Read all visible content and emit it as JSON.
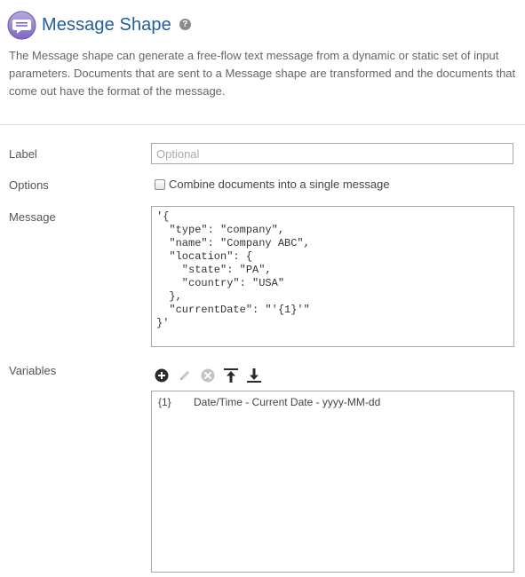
{
  "header": {
    "title": "Message Shape",
    "help_glyph": "?",
    "icon": "message-shape-icon"
  },
  "description": "The Message shape can generate a free-flow text message from a dynamic or static set of input parameters. Documents that are sent to a Message shape are transformed and the documents that come out have the format of the message.",
  "form": {
    "label": {
      "label": "Label",
      "value": "",
      "placeholder": "Optional"
    },
    "options": {
      "label": "Options",
      "checkbox_label": "Combine documents into a single message",
      "checked": false
    },
    "message": {
      "label": "Message",
      "value": "'{\n  \"type\": \"company\",\n  \"name\": \"Company ABC\",\n  \"location\": {\n    \"state\": \"PA\",\n    \"country\": \"USA\"\n  },\n  \"currentDate\": \"'{1}'\"\n}'"
    },
    "variables": {
      "label": "Variables",
      "toolbar": [
        "add-icon",
        "edit-icon",
        "remove-icon",
        "move-up-icon",
        "move-down-icon"
      ],
      "items": [
        {
          "key": "{1}",
          "value": "Date/Time - Current Date - yyyy-MM-dd"
        }
      ]
    }
  },
  "colors": {
    "title": "#1f5e99",
    "icon_bubble": "#8e7cc3",
    "text": "#666666",
    "border": "#a9a9a9"
  }
}
